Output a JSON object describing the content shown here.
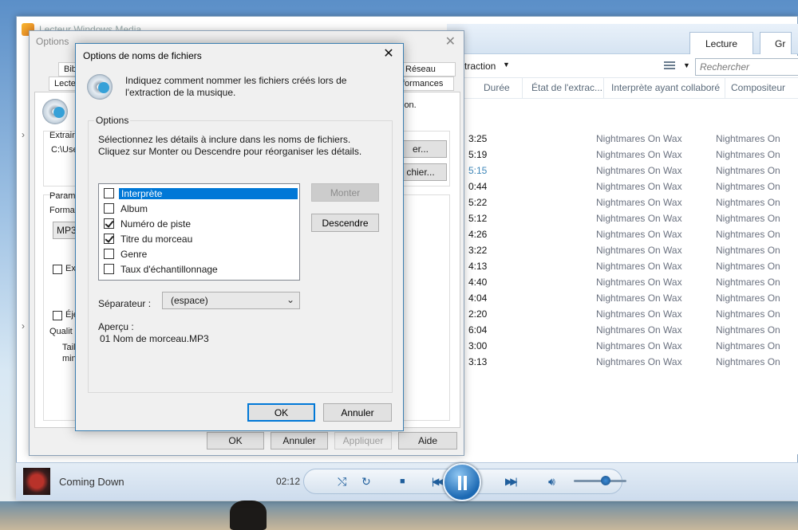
{
  "player": {
    "window_title": "Lecteur Windows Media",
    "tabs": [
      "Lecture",
      "Gr"
    ],
    "toolbar_extraction": "xtraction",
    "search_placeholder": "Rechercher",
    "columns": [
      "Durée",
      "État de l'extrac...",
      "Interprète ayant collaboré",
      "Compositeur"
    ],
    "rows": [
      {
        "duration": "3:25",
        "artist": "Nightmares On Wax",
        "composer": "Nightmares On"
      },
      {
        "duration": "5:19",
        "artist": "Nightmares On Wax",
        "composer": "Nightmares On"
      },
      {
        "duration": "5:15",
        "artist": "Nightmares On Wax",
        "composer": "Nightmares On",
        "highlight": true
      },
      {
        "duration": "0:44",
        "artist": "Nightmares On Wax",
        "composer": "Nightmares On"
      },
      {
        "duration": "5:22",
        "artist": "Nightmares On Wax",
        "composer": "Nightmares On"
      },
      {
        "duration": "5:12",
        "artist": "Nightmares On Wax",
        "composer": "Nightmares On"
      },
      {
        "duration": "4:26",
        "artist": "Nightmares On Wax",
        "composer": "Nightmares On"
      },
      {
        "duration": "3:22",
        "artist": "Nightmares On Wax",
        "composer": "Nightmares On"
      },
      {
        "duration": "4:13",
        "artist": "Nightmares On Wax",
        "composer": "Nightmares On"
      },
      {
        "duration": "4:40",
        "artist": "Nightmares On Wax",
        "composer": "Nightmares On"
      },
      {
        "duration": "4:04",
        "artist": "Nightmares On Wax",
        "composer": "Nightmares On"
      },
      {
        "duration": "2:20",
        "artist": "Nightmares On Wax",
        "composer": "Nightmares On"
      },
      {
        "duration": "6:04",
        "artist": "Nightmares On Wax",
        "composer": "Nightmares On"
      },
      {
        "duration": "3:00",
        "artist": "Nightmares On Wax",
        "composer": "Nightmares On"
      },
      {
        "duration": "3:13",
        "artist": "Nightmares On Wax",
        "composer": "Nightmares On"
      }
    ],
    "now_playing": "Coming Down",
    "elapsed": "02:12",
    "volume_fraction": 0.6
  },
  "options_dialog": {
    "title": "Options",
    "tabs_row1": [
      "Biblio",
      "Réseau"
    ],
    "tabs_row2": [
      "Lecte",
      "formances"
    ],
    "side_text": "ion.",
    "extract_label": "Extrair",
    "path": "C:\\Use",
    "browse1": "er...",
    "browse2": "chier...",
    "params_label": "Parame",
    "format_label": "Format",
    "format_value": "MP3",
    "ext_label": "Ext",
    "eject_label": "Éje",
    "quality_label": "Qualit",
    "size_label1": "Taill",
    "size_label2": "mini",
    "buttons": {
      "ok": "OK",
      "cancel": "Annuler",
      "apply": "Appliquer",
      "help": "Aide"
    }
  },
  "filename_dialog": {
    "title": "Options de noms de fichiers",
    "intro": "Indiquez comment nommer les fichiers créés lors de l'extraction de la musique.",
    "group_label": "Options",
    "description": "Sélectionnez les détails à inclure dans les noms de fichiers. Cliquez sur Monter ou Descendre pour réorganiser les détails.",
    "details": [
      {
        "label": "Interprète",
        "checked": false,
        "selected": true
      },
      {
        "label": "Album",
        "checked": false,
        "selected": false
      },
      {
        "label": "Numéro de piste",
        "checked": true,
        "selected": false
      },
      {
        "label": "Titre du morceau",
        "checked": true,
        "selected": false
      },
      {
        "label": "Genre",
        "checked": false,
        "selected": false
      },
      {
        "label": "Taux d'échantillonnage",
        "checked": false,
        "selected": false
      }
    ],
    "move_up": "Monter",
    "move_down": "Descendre",
    "separator_label": "Séparateur :",
    "separator_value": "(espace)",
    "preview_label": "Aperçu :",
    "preview_value": "01 Nom de morceau.MP3",
    "ok": "OK",
    "cancel": "Annuler"
  }
}
